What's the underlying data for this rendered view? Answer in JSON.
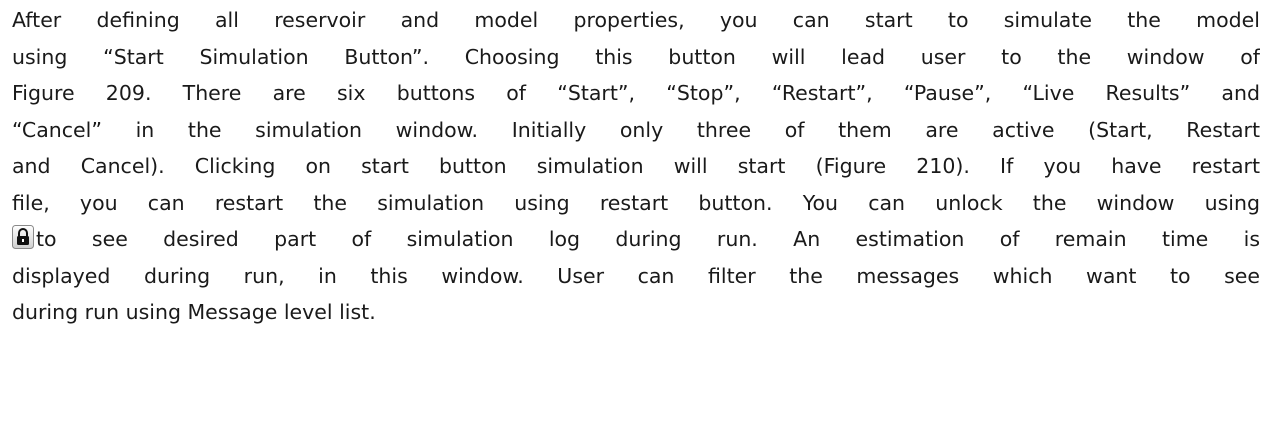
{
  "paragraph": {
    "lines": [
      "After defining all reservoir and model properties, you can start to simulate the model",
      "using “Start Simulation Button”. Choosing this button will lead user to the window of",
      "Figure 209. There are six buttons of “Start”, “Stop”, “Restart”, “Pause”, “Live Results” and",
      "“Cancel” in the simulation window. Initially only three of them are active (Start, Restart",
      "and Cancel). Clicking on start button simulation will start (Figure 210). If you have restart",
      "file, you can restart the simulation using restart button. You can unlock the window using",
      "to see desired part of simulation log during run. An estimation of remain time is",
      "displayed during run, in this window. User can filter the messages which want to see",
      "during run using Message level list."
    ],
    "inline_icon": "lock-icon"
  }
}
